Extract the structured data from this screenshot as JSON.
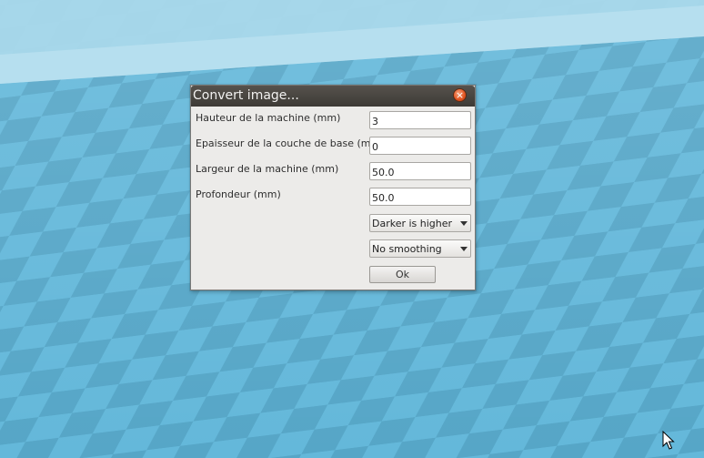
{
  "dialog": {
    "title": "Convert image...",
    "close_glyph": "×",
    "fields": [
      {
        "label": "Hauteur de la machine (mm)",
        "value": "3"
      },
      {
        "label": "Epaisseur de la couche de base (mm)",
        "value": "0"
      },
      {
        "label": "Largeur de la machine (mm)",
        "value": "50.0"
      },
      {
        "label": "Profondeur (mm)",
        "value": "50.0"
      }
    ],
    "height_mode": {
      "selected": "Darker is higher"
    },
    "smoothing": {
      "selected": "No smoothing"
    },
    "ok_label": "Ok"
  },
  "colors": {
    "tile_light": "#64b8da",
    "tile_dark": "#56a6c7",
    "platform_edge": "#a9d8ea",
    "titlebar": "#46423e",
    "dialog_bg": "#ecebe9",
    "close_button": "#e2531f"
  },
  "icons": {
    "close": "close-icon",
    "dropdown": "chevron-down-icon",
    "pointer": "mouse-cursor-icon"
  }
}
